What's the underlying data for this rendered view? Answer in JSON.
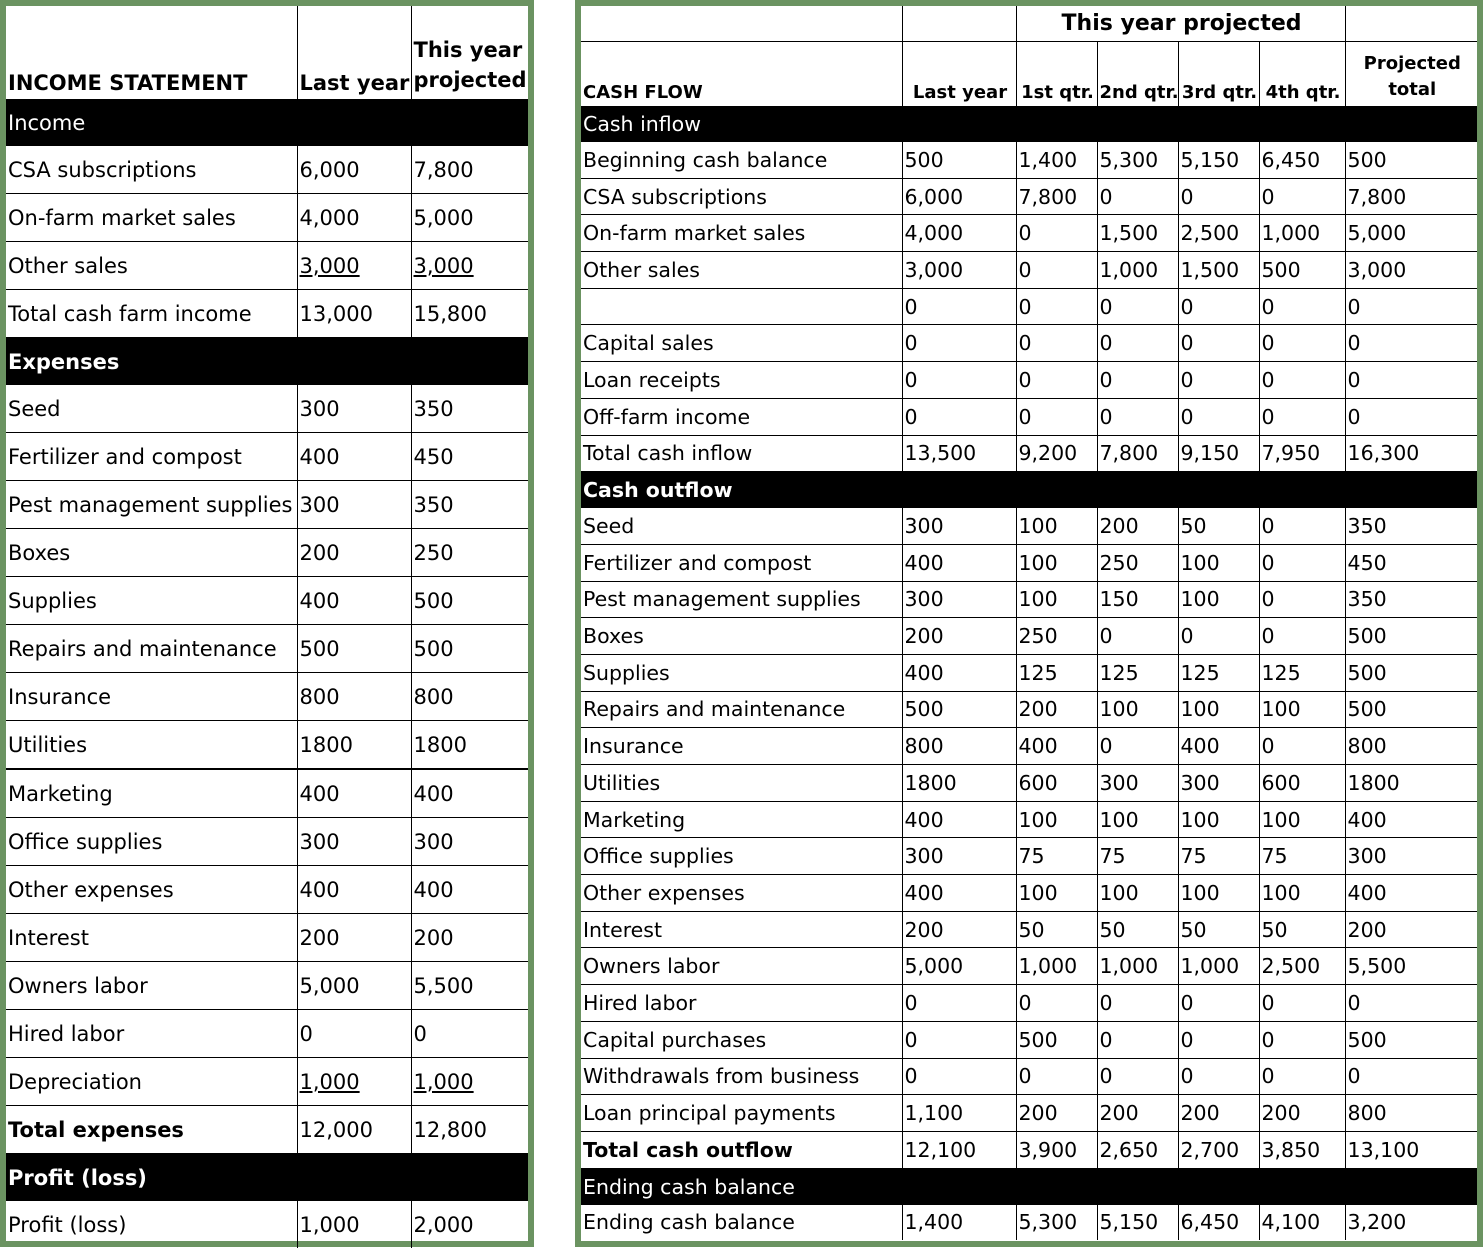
{
  "income_statement": {
    "title": "INCOME STATEMENT",
    "columns": [
      "Last year",
      "This year projected"
    ],
    "income_header": "Income",
    "income_rows": [
      {
        "label": "CSA subscriptions",
        "last": "6,000",
        "proj": "7,800"
      },
      {
        "label": "On-farm market sales",
        "last": "4,000",
        "proj": "5,000"
      },
      {
        "label": "Other sales",
        "last": "3,000",
        "proj": "3,000"
      },
      {
        "label": "Total cash farm income",
        "last": "13,000",
        "proj": "15,800"
      }
    ],
    "expenses_header": "Expenses",
    "expense_rows": [
      {
        "label": "Seed",
        "last": "300",
        "proj": "350"
      },
      {
        "label": "Fertilizer and compost",
        "last": "400",
        "proj": "450"
      },
      {
        "label": "Pest management supplies",
        "last": "300",
        "proj": "350"
      },
      {
        "label": "Boxes",
        "last": "200",
        "proj": "250"
      },
      {
        "label": "Supplies",
        "last": "400",
        "proj": "500"
      },
      {
        "label": "Repairs and maintenance",
        "last": "500",
        "proj": "500"
      },
      {
        "label": "Insurance",
        "last": "800",
        "proj": "800"
      },
      {
        "label": "Utilities",
        "last": "1800",
        "proj": "1800"
      },
      {
        "label": "Marketing",
        "last": "400",
        "proj": "400"
      },
      {
        "label": "Office supplies",
        "last": "300",
        "proj": "300"
      },
      {
        "label": "Other expenses",
        "last": "400",
        "proj": "400"
      },
      {
        "label": "Interest",
        "last": "200",
        "proj": "200"
      },
      {
        "label": "Owners labor",
        "last": "5,000",
        "proj": "5,500"
      },
      {
        "label": "Hired labor",
        "last": "0",
        "proj": "0"
      },
      {
        "label": "Depreciation",
        "last": "1,000",
        "proj": "1,000"
      },
      {
        "label": "Total expenses",
        "last": "12,000",
        "proj": "12,800"
      }
    ],
    "profit_header": "Profit (loss)",
    "profit_row": {
      "label": "Profit (loss)",
      "last": "1,000",
      "proj": "2,000"
    }
  },
  "cash_flow": {
    "title": "CASH FLOW",
    "group_header": "This year projected",
    "columns": [
      "Last year",
      "1st qtr.",
      "2nd qtr.",
      "3rd qtr.",
      "4th qtr.",
      "Projected total"
    ],
    "inflow_header": "Cash inflow",
    "inflow_rows": [
      {
        "label": "Beginning cash balance",
        "v": [
          "500",
          "1,400",
          "5,300",
          "5,150",
          "6,450",
          "500"
        ]
      },
      {
        "label": "CSA subscriptions",
        "v": [
          "6,000",
          "7,800",
          "0",
          "0",
          "0",
          "7,800"
        ]
      },
      {
        "label": "On-farm market sales",
        "v": [
          "4,000",
          "0",
          "1,500",
          "2,500",
          "1,000",
          "5,000"
        ]
      },
      {
        "label": "Other sales",
        "v": [
          "3,000",
          "0",
          "1,000",
          "1,500",
          "500",
          "3,000"
        ]
      },
      {
        "label": "",
        "v": [
          "0",
          "0",
          "0",
          "0",
          "0",
          "0"
        ]
      },
      {
        "label": "Capital sales",
        "v": [
          "0",
          "0",
          "0",
          "0",
          "0",
          "0"
        ]
      },
      {
        "label": "Loan receipts",
        "v": [
          "0",
          "0",
          "0",
          "0",
          "0",
          "0"
        ]
      },
      {
        "label": "Off-farm income",
        "v": [
          "0",
          "0",
          "0",
          "0",
          "0",
          "0"
        ]
      },
      {
        "label": "Total cash inflow",
        "v": [
          "13,500",
          "9,200",
          "7,800",
          "9,150",
          "7,950",
          "16,300"
        ]
      }
    ],
    "outflow_header": "Cash outflow",
    "outflow_rows": [
      {
        "label": "Seed",
        "v": [
          "300",
          "100",
          "200",
          "50",
          "0",
          "350"
        ]
      },
      {
        "label": "Fertilizer and compost",
        "v": [
          "400",
          "100",
          "250",
          "100",
          "0",
          "450"
        ]
      },
      {
        "label": "Pest management supplies",
        "v": [
          "300",
          "100",
          "150",
          "100",
          "0",
          "350"
        ]
      },
      {
        "label": "Boxes",
        "v": [
          "200",
          "250",
          "0",
          "0",
          "0",
          "500"
        ]
      },
      {
        "label": "Supplies",
        "v": [
          "400",
          "125",
          "125",
          "125",
          "125",
          "500"
        ]
      },
      {
        "label": "Repairs and maintenance",
        "v": [
          "500",
          "200",
          "100",
          "100",
          "100",
          "500"
        ]
      },
      {
        "label": "Insurance",
        "v": [
          "800",
          "400",
          "0",
          "400",
          "0",
          "800"
        ]
      },
      {
        "label": "Utilities",
        "v": [
          "1800",
          "600",
          "300",
          "300",
          "600",
          "1800"
        ]
      },
      {
        "label": "Marketing",
        "v": [
          "400",
          "100",
          "100",
          "100",
          "100",
          "400"
        ]
      },
      {
        "label": "Office supplies",
        "v": [
          "300",
          "75",
          "75",
          "75",
          "75",
          "300"
        ]
      },
      {
        "label": "Other expenses",
        "v": [
          "400",
          "100",
          "100",
          "100",
          "100",
          "400"
        ]
      },
      {
        "label": "Interest",
        "v": [
          "200",
          "50",
          "50",
          "50",
          "50",
          "200"
        ]
      },
      {
        "label": "Owners labor",
        "v": [
          "5,000",
          "1,000",
          "1,000",
          "1,000",
          "2,500",
          "5,500"
        ]
      },
      {
        "label": "Hired labor",
        "v": [
          "0",
          "0",
          "0",
          "0",
          "0",
          "0"
        ]
      },
      {
        "label": "Capital purchases",
        "v": [
          "0",
          "500",
          "0",
          "0",
          "0",
          "500"
        ]
      },
      {
        "label": "Withdrawals from business",
        "v": [
          "0",
          "0",
          "0",
          "0",
          "0",
          "0"
        ]
      },
      {
        "label": "Loan principal payments",
        "v": [
          "1,100",
          "200",
          "200",
          "200",
          "200",
          "800"
        ]
      },
      {
        "label": "Total cash outflow",
        "v": [
          "12,100",
          "3,900",
          "2,650",
          "2,700",
          "3,850",
          "13,100"
        ]
      }
    ],
    "ending_header": "Ending cash balance",
    "ending_row": {
      "label": "Ending cash balance",
      "v": [
        "1,400",
        "5,300",
        "5,150",
        "6,450",
        "4,100",
        "3,200"
      ]
    }
  },
  "colors": {
    "frame_green": "#6b9361",
    "section_bar": "#000000"
  }
}
